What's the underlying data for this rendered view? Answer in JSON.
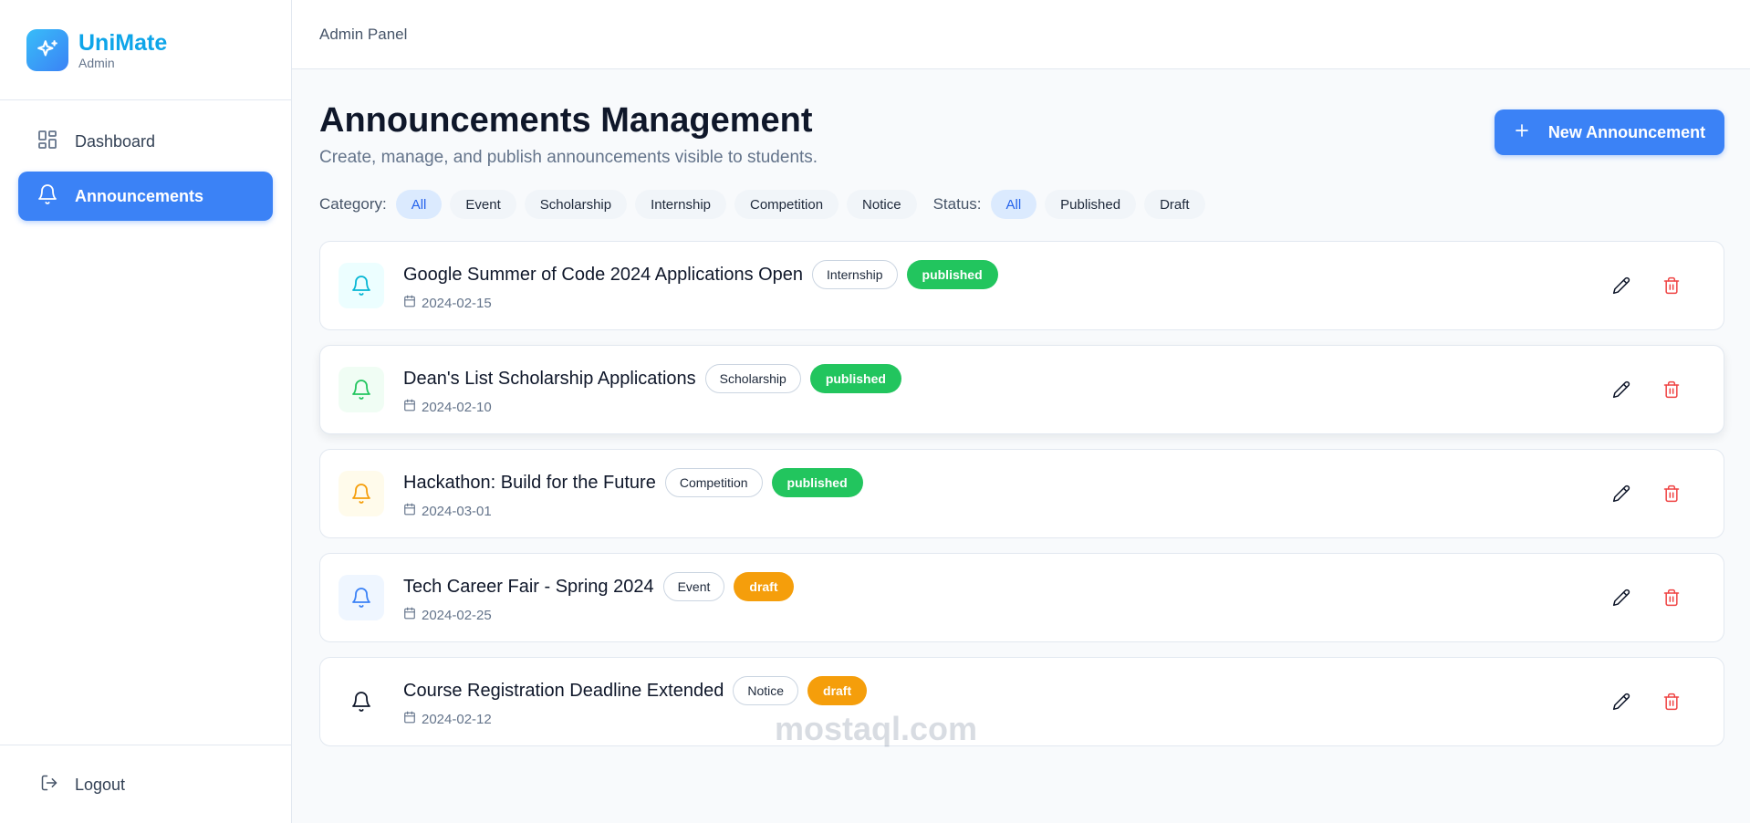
{
  "brand": {
    "name": "UniMate",
    "subtitle": "Admin"
  },
  "sidebar": {
    "items": [
      {
        "label": "Dashboard",
        "icon": "dashboard-icon",
        "active": false
      },
      {
        "label": "Announcements",
        "icon": "bell-icon",
        "active": true
      }
    ],
    "logout_label": "Logout"
  },
  "topbar": {
    "title": "Admin Panel"
  },
  "page": {
    "title": "Announcements Management",
    "subtitle": "Create, manage, and publish announcements visible to students.",
    "new_button_label": "New Announcement"
  },
  "filters": {
    "category_label": "Category:",
    "categories": [
      "All",
      "Event",
      "Scholarship",
      "Internship",
      "Competition",
      "Notice"
    ],
    "category_selected": "All",
    "status_label": "Status:",
    "statuses": [
      "All",
      "Published",
      "Draft"
    ],
    "status_selected": "All"
  },
  "announcements": [
    {
      "title": "Google Summer of Code 2024 Applications Open",
      "category": "Internship",
      "status": "published",
      "date": "2024-02-15",
      "icon_color": "#06b6d4",
      "icon_bg": "#ecfeff"
    },
    {
      "title": "Dean's List Scholarship Applications",
      "category": "Scholarship",
      "status": "published",
      "date": "2024-02-10",
      "icon_color": "#22c55e",
      "icon_bg": "#f0fdf4"
    },
    {
      "title": "Hackathon: Build for the Future",
      "category": "Competition",
      "status": "published",
      "date": "2024-03-01",
      "icon_color": "#f59e0b",
      "icon_bg": "#fffbeb"
    },
    {
      "title": "Tech Career Fair - Spring 2024",
      "category": "Event",
      "status": "draft",
      "date": "2024-02-25",
      "icon_color": "#3b82f6",
      "icon_bg": "#eff6ff"
    },
    {
      "title": "Course Registration Deadline Extended",
      "category": "Notice",
      "status": "draft",
      "date": "2024-02-12",
      "icon_color": "#0f172a",
      "icon_bg": "#ffffff"
    }
  ],
  "status_colors": {
    "published": "#22c55e",
    "draft": "#f59e0b"
  },
  "watermark": "mostaql.com"
}
